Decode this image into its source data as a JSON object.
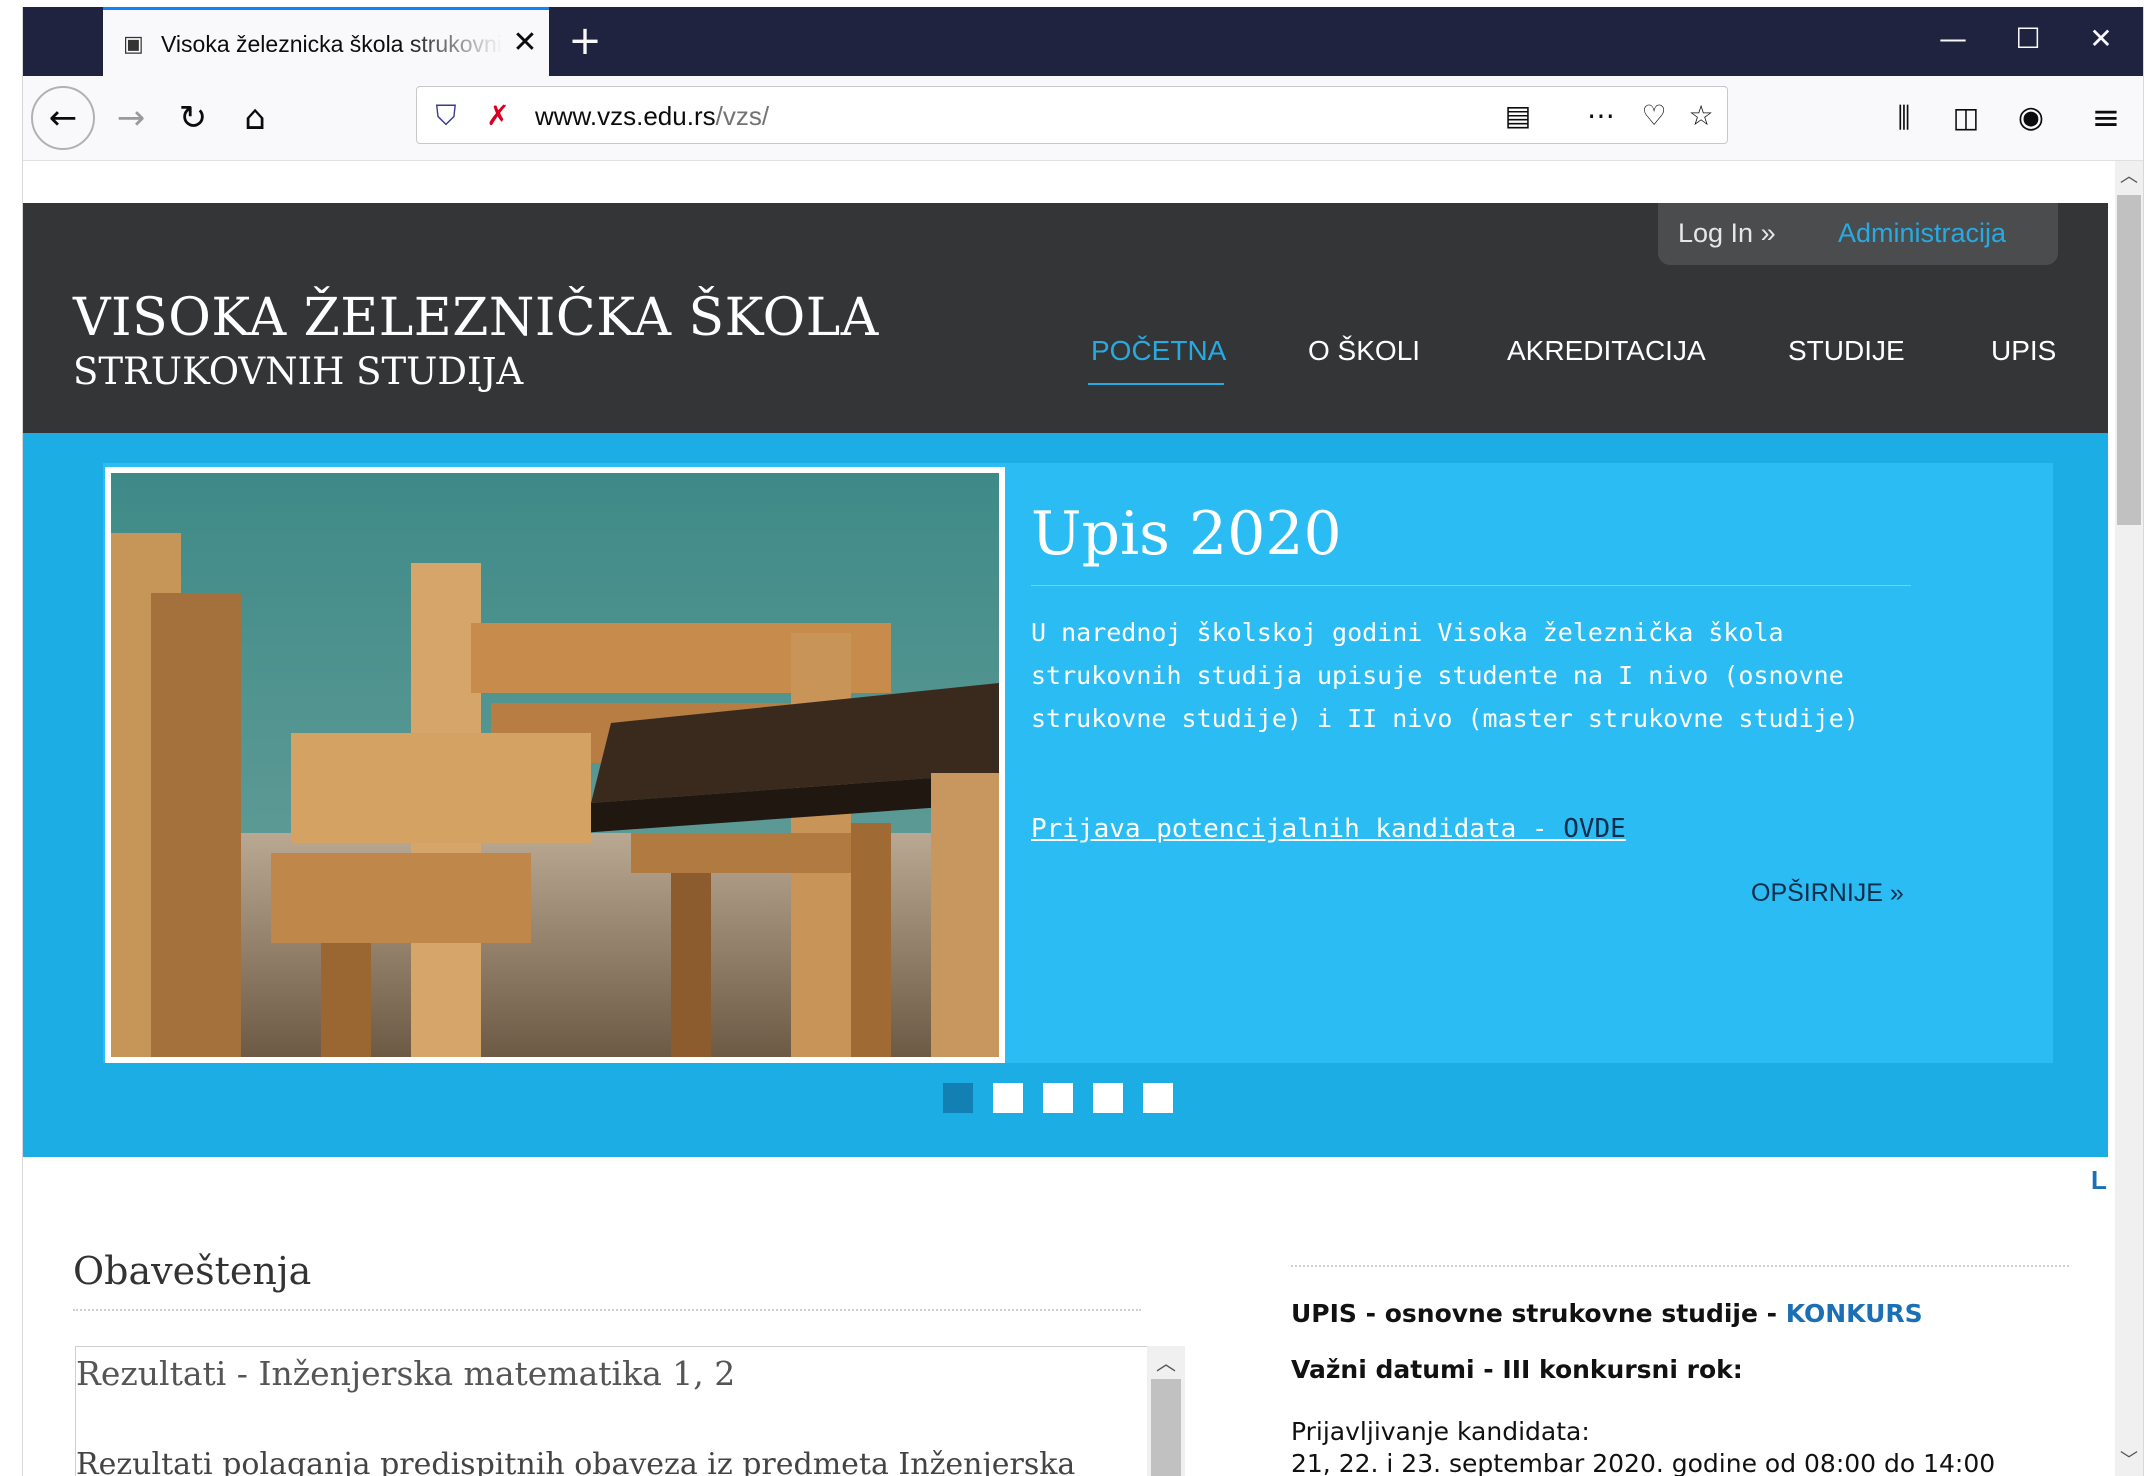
{
  "browser": {
    "tab_title": "Visoka železnicka škola strukovnih studija",
    "tab_close": "✕",
    "new_tab": "+",
    "window_controls": {
      "minimize": "—",
      "maximize": "☐",
      "close": "✕"
    },
    "url_host": "www.vzs.edu.rs",
    "url_path": "/vzs/",
    "toolbar_icons": [
      "back-arrow-icon",
      "forward-arrow-icon",
      "reload-icon",
      "home-icon",
      "shield-icon",
      "insecure-lock-icon",
      "reader-view-icon",
      "more-actions-icon",
      "pocket-icon",
      "bookmark-star-icon",
      "library-icon",
      "sidebar-icon",
      "account-icon",
      "menu-icon"
    ]
  },
  "header": {
    "login": "Log In »",
    "admin": "Administracija",
    "title": "VISOKA ŽELEZNIČKA ŠKOLA",
    "subtitle": "STRUKOVNIH STUDIJA",
    "nav": [
      "POČETNA",
      "O ŠKOLI",
      "AKREDITACIJA",
      "STUDIJE",
      "UPIS"
    ],
    "nav_active_index": 0,
    "accent_color": "#27aae1"
  },
  "slider": {
    "title": "Upis 2020",
    "text": "U narednoj školskoj godini Visoka železnička škola strukovnih studija upisuje studente na I nivo (osnovne strukovne studije) i II nivo (master strukovne studije)",
    "link_text": "Prijava potencijalnih kandidata - ",
    "link_strong": "OVDE",
    "more": "OPŠIRNIJE »",
    "dots_count": 5,
    "active_dot": 1,
    "background_color": "#1cade4"
  },
  "edge_glyph": "L",
  "notices": {
    "heading": "Obaveštenja",
    "item_title": "Rezultati - Inženjerska matematika 1, 2",
    "item_text": "Rezultati polaganja predispitnih obaveza iz predmeta Inženjerska"
  },
  "sidebar": {
    "upis_label": "UPIS - osnovne strukovne studije - ",
    "upis_link": "KONKURS",
    "dates_label": "Važni datumi - III konkursni rok:",
    "registration_label": "Prijavljivanje kandidata:",
    "registration_dates": "21, 22. i 23. septembar 2020. godine od 08:00 do 14:00"
  }
}
